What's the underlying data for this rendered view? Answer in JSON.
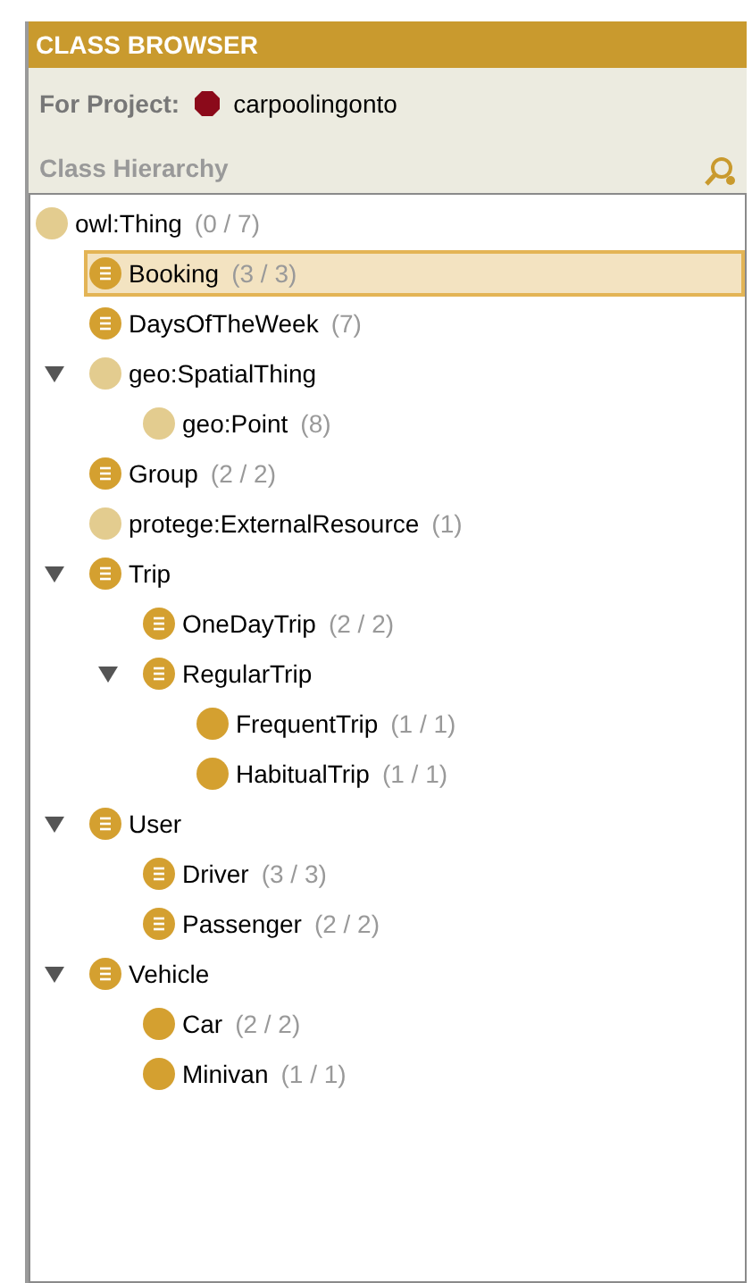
{
  "header": {
    "title": "CLASS BROWSER"
  },
  "project": {
    "label": "For Project:",
    "name": "carpoolingonto"
  },
  "hierarchy": {
    "title": "Class Hierarchy",
    "tree": [
      {
        "name": "owl:Thing",
        "count": "(0 / 7)",
        "kind": "primitive",
        "selected": false,
        "children": [
          {
            "name": "Booking",
            "count": "(3 / 3)",
            "kind": "defined",
            "selected": true
          },
          {
            "name": "DaysOfTheWeek",
            "count": "(7)",
            "kind": "defined",
            "selected": false
          },
          {
            "name": "geo:SpatialThing",
            "kind": "primitive",
            "selected": false,
            "expanded": true,
            "children": [
              {
                "name": "geo:Point",
                "count": "(8)",
                "kind": "primitive",
                "selected": false
              }
            ]
          },
          {
            "name": "Group",
            "count": "(2 / 2)",
            "kind": "defined",
            "selected": false
          },
          {
            "name": "protege:ExternalResource",
            "count": "(1)",
            "kind": "primitive",
            "selected": false
          },
          {
            "name": "Trip",
            "kind": "defined",
            "selected": false,
            "expanded": true,
            "children": [
              {
                "name": "OneDayTrip",
                "count": "(2 / 2)",
                "kind": "defined",
                "selected": false
              },
              {
                "name": "RegularTrip",
                "kind": "defined",
                "selected": false,
                "expanded": true,
                "children": [
                  {
                    "name": "FrequentTrip",
                    "count": "(1 / 1)",
                    "kind": "plain",
                    "selected": false
                  },
                  {
                    "name": "HabitualTrip",
                    "count": "(1 / 1)",
                    "kind": "plain",
                    "selected": false
                  }
                ]
              }
            ]
          },
          {
            "name": "User",
            "kind": "defined",
            "selected": false,
            "expanded": true,
            "children": [
              {
                "name": "Driver",
                "count": "(3 / 3)",
                "kind": "defined",
                "selected": false
              },
              {
                "name": "Passenger",
                "count": "(2 / 2)",
                "kind": "defined",
                "selected": false
              }
            ]
          },
          {
            "name": "Vehicle",
            "kind": "defined",
            "selected": false,
            "expanded": true,
            "children": [
              {
                "name": "Car",
                "count": "(2 / 2)",
                "kind": "plain",
                "selected": false
              },
              {
                "name": "Minivan",
                "count": "(1 / 1)",
                "kind": "plain",
                "selected": false
              }
            ]
          }
        ]
      }
    ]
  }
}
